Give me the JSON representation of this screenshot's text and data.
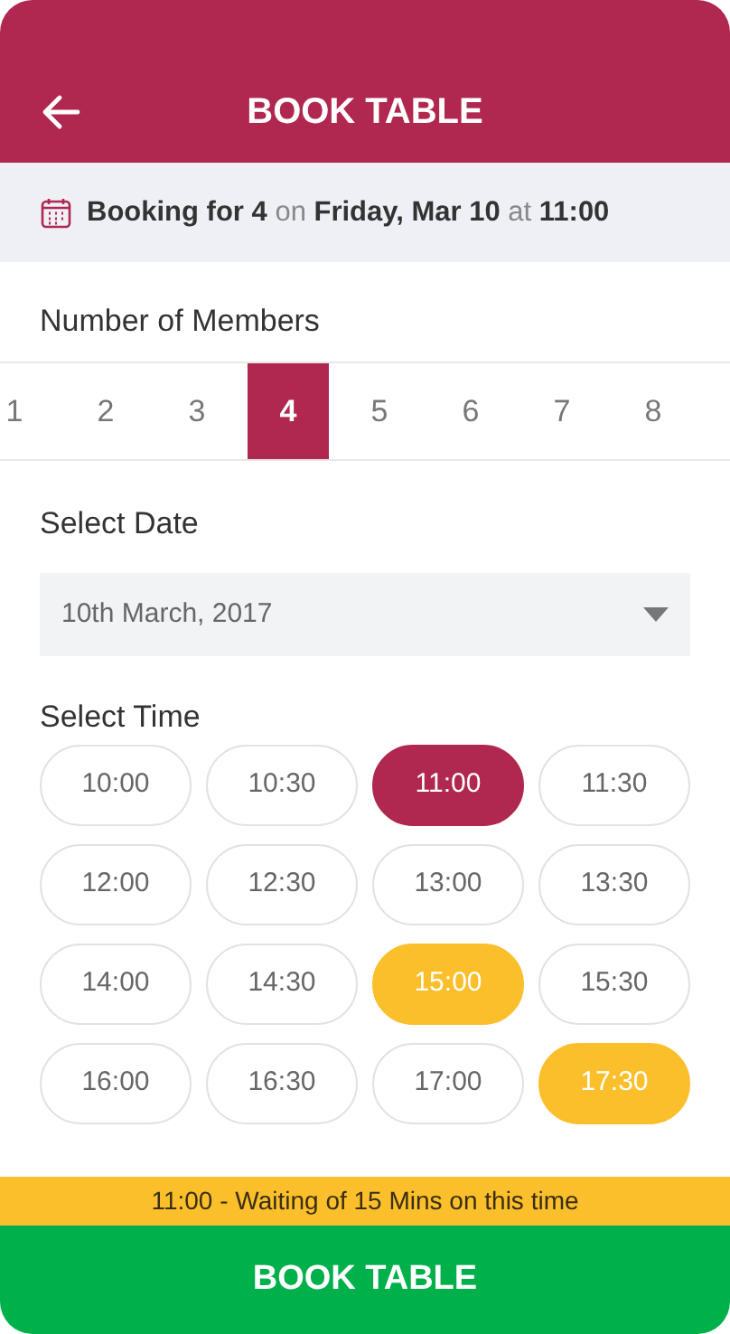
{
  "header": {
    "title": "BOOK TABLE"
  },
  "summary": {
    "text": "**Booking for 4** on **Friday, Mar 10** at **11:00**"
  },
  "members": {
    "label": "Number of Members",
    "options": [
      {
        "label": "1",
        "selected": false
      },
      {
        "label": "2",
        "selected": false
      },
      {
        "label": "3",
        "selected": false
      },
      {
        "label": "4",
        "selected": true
      },
      {
        "label": "5",
        "selected": false
      },
      {
        "label": "6",
        "selected": false
      },
      {
        "label": "7",
        "selected": false
      },
      {
        "label": "8",
        "selected": false
      }
    ]
  },
  "date": {
    "label": "Select Date",
    "value": "10th March, 2017"
  },
  "time": {
    "label": "Select Time",
    "slots": [
      {
        "label": "10:00",
        "selected": false,
        "waiting": false
      },
      {
        "label": "10:30",
        "selected": false,
        "waiting": false
      },
      {
        "label": "11:00",
        "selected": true,
        "waiting": false
      },
      {
        "label": "11:30",
        "selected": false,
        "waiting": false
      },
      {
        "label": "12:00",
        "selected": false,
        "waiting": false
      },
      {
        "label": "12:30",
        "selected": false,
        "waiting": false
      },
      {
        "label": "13:00",
        "selected": false,
        "waiting": false
      },
      {
        "label": "13:30",
        "selected": false,
        "waiting": false
      },
      {
        "label": "14:00",
        "selected": false,
        "waiting": false
      },
      {
        "label": "14:30",
        "selected": false,
        "waiting": false
      },
      {
        "label": "15:00",
        "selected": false,
        "waiting": true
      },
      {
        "label": "15:30",
        "selected": false,
        "waiting": false
      },
      {
        "label": "16:00",
        "selected": false,
        "waiting": false
      },
      {
        "label": "16:30",
        "selected": false,
        "waiting": false
      },
      {
        "label": "17:00",
        "selected": false,
        "waiting": false
      },
      {
        "label": "17:30",
        "selected": false,
        "waiting": true
      }
    ]
  },
  "notice": "11:00 - Waiting of 15 Mins on this time",
  "button": "BOOK TABLE"
}
